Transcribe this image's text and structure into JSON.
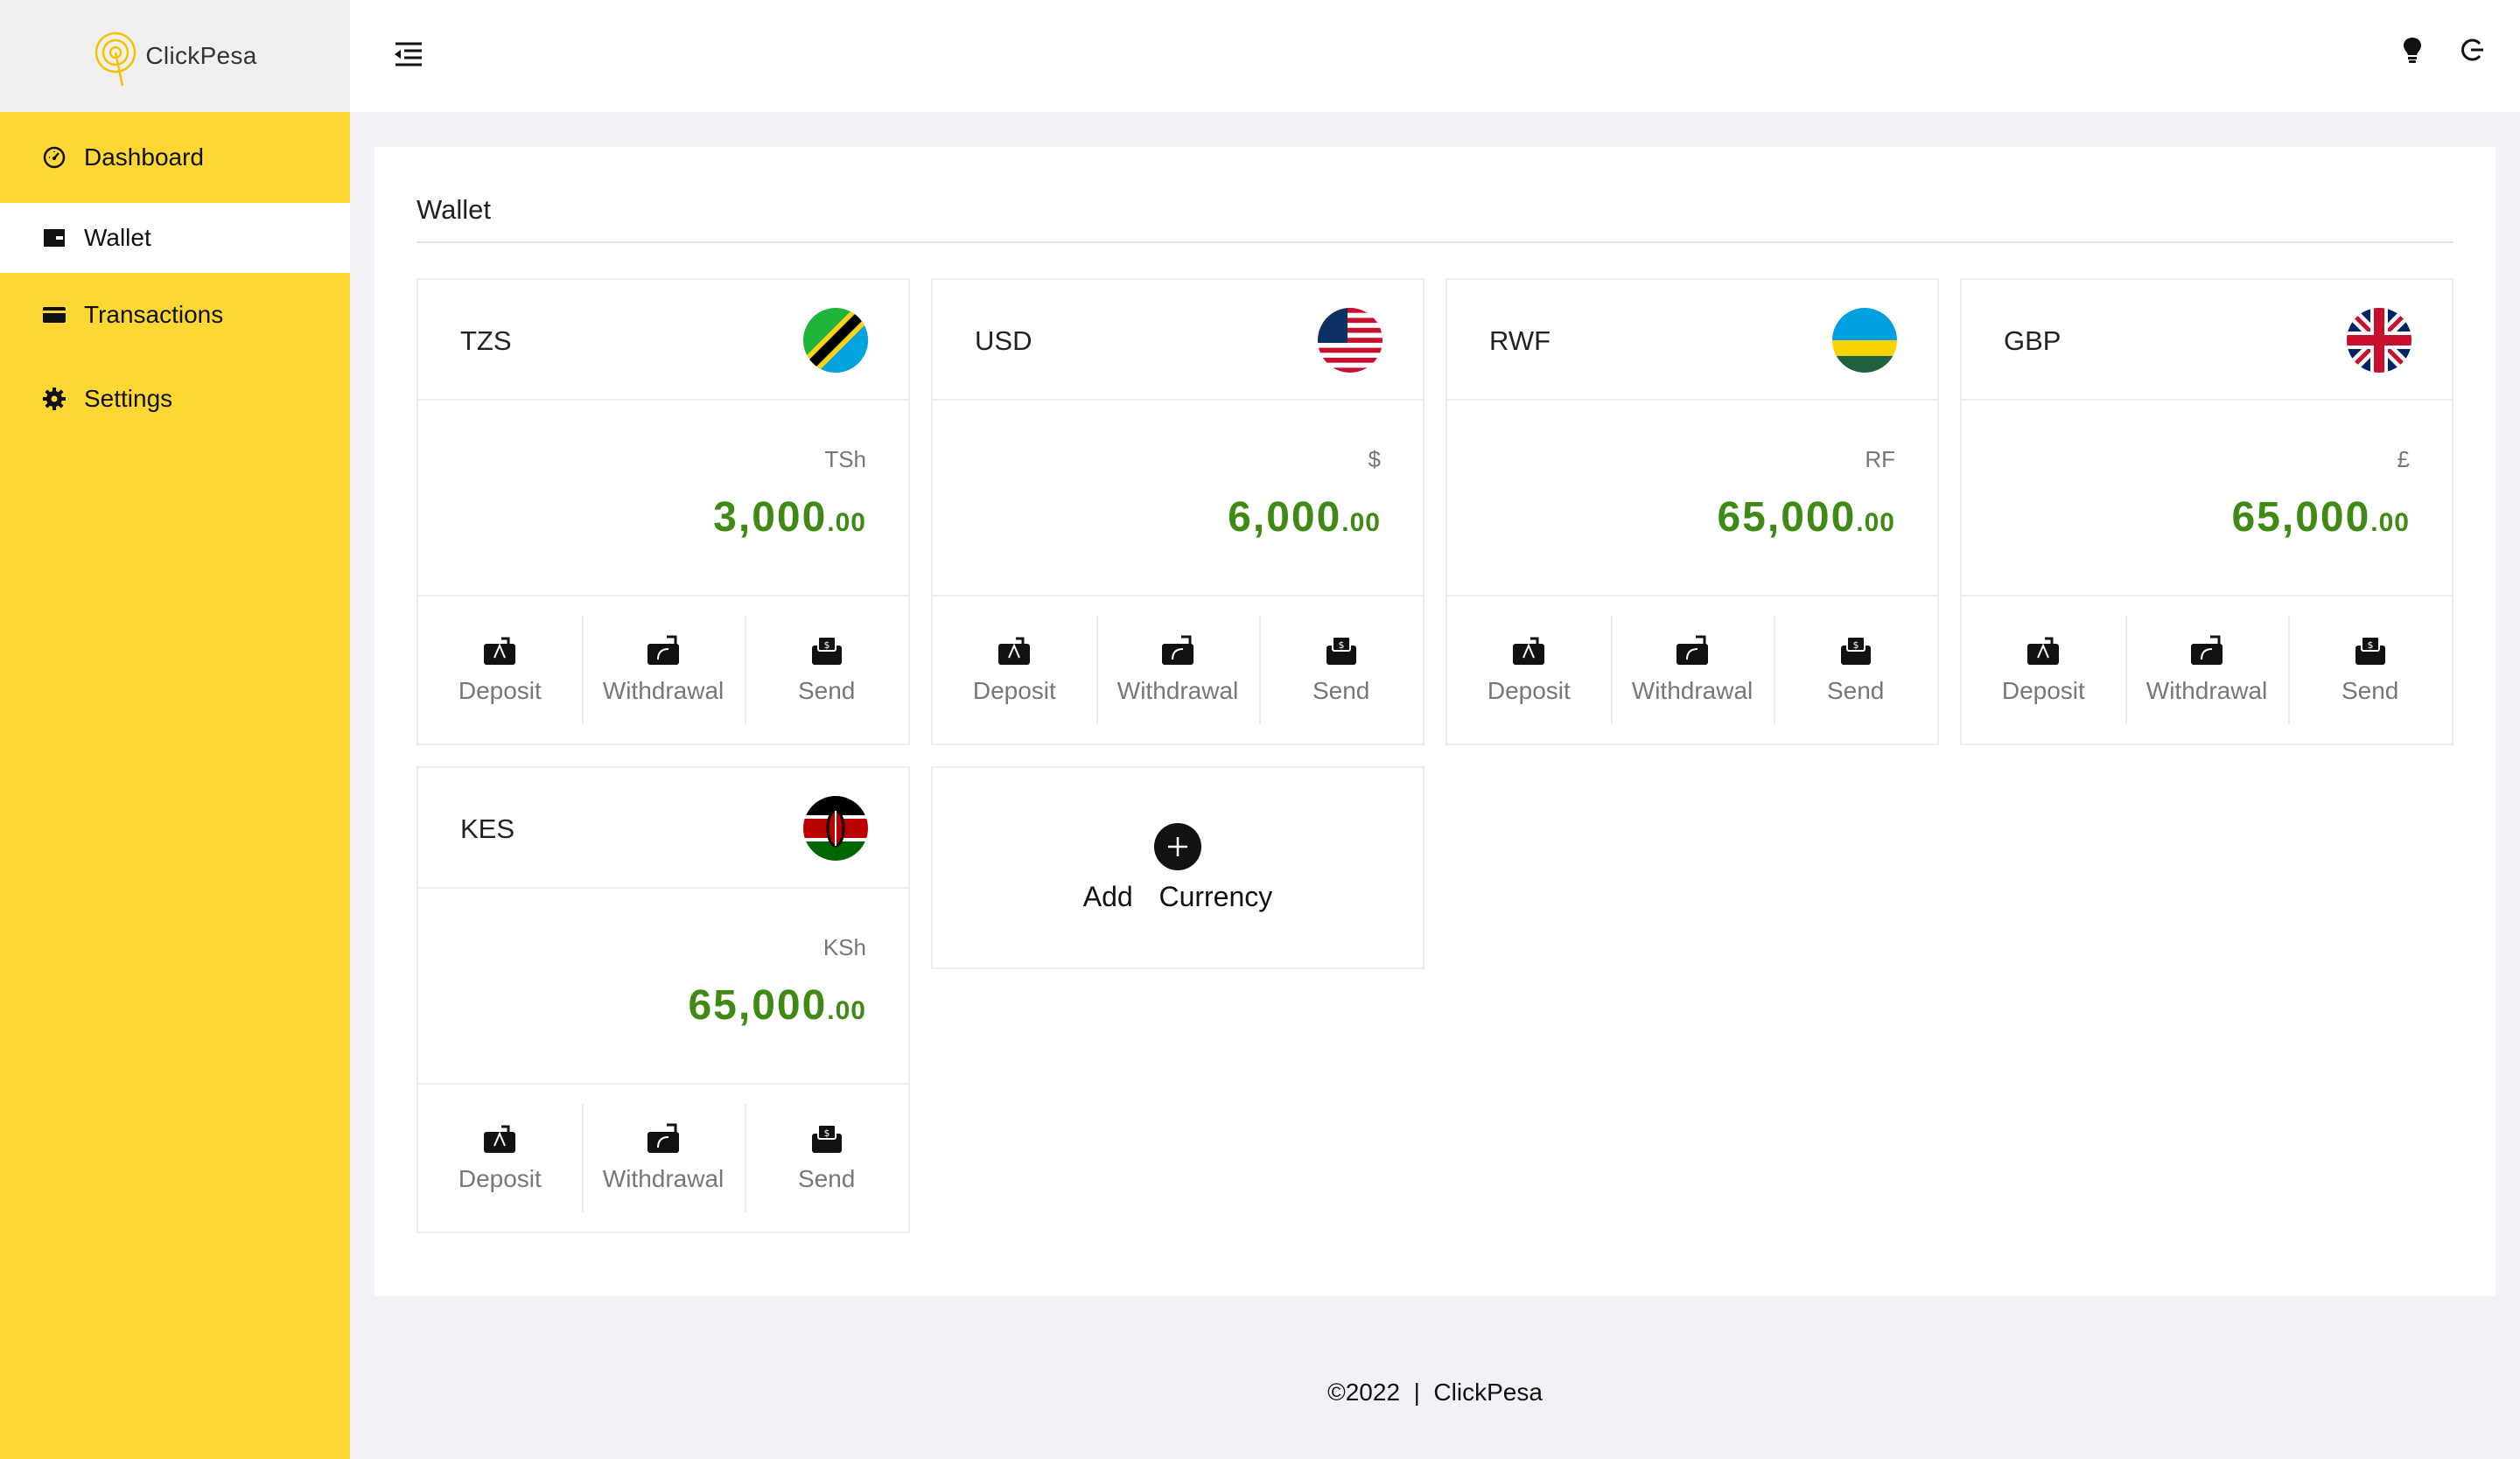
{
  "brand": {
    "name": "ClickPesa",
    "accent": "#fdd835",
    "amount_color": "#3f8a14"
  },
  "sidebar": {
    "items": [
      {
        "label": "Dashboard",
        "icon": "speedometer-icon"
      },
      {
        "label": "Wallet",
        "icon": "wallet-icon",
        "active": true
      },
      {
        "label": "Transactions",
        "icon": "credit-card-icon"
      },
      {
        "label": "Settings",
        "icon": "gear-icon"
      }
    ]
  },
  "header": {
    "icons": [
      "menu-fold-icon",
      "lightbulb-icon",
      "logout-icon"
    ]
  },
  "main": {
    "title": "Wallet"
  },
  "wallets": [
    {
      "code": "TZS",
      "flag": "tanzania-flag",
      "symbol": "TSh",
      "amount": "3,000",
      "cents": ".00"
    },
    {
      "code": "USD",
      "flag": "usa-flag",
      "symbol": "$",
      "amount": "6,000",
      "cents": ".00"
    },
    {
      "code": "RWF",
      "flag": "rwanda-flag",
      "symbol": "RF",
      "amount": "65,000",
      "cents": ".00"
    },
    {
      "code": "GBP",
      "flag": "uk-flag",
      "symbol": "£",
      "amount": "65,000",
      "cents": ".00"
    },
    {
      "code": "KES",
      "flag": "kenya-flag",
      "symbol": "KSh",
      "amount": "65,000",
      "cents": ".00"
    }
  ],
  "actions": {
    "deposit": "Deposit",
    "withdrawal": "Withdrawal",
    "send": "Send"
  },
  "add_currency": {
    "label": "Add  Currency"
  },
  "footer": {
    "text": "©2022  |  ClickPesa"
  }
}
